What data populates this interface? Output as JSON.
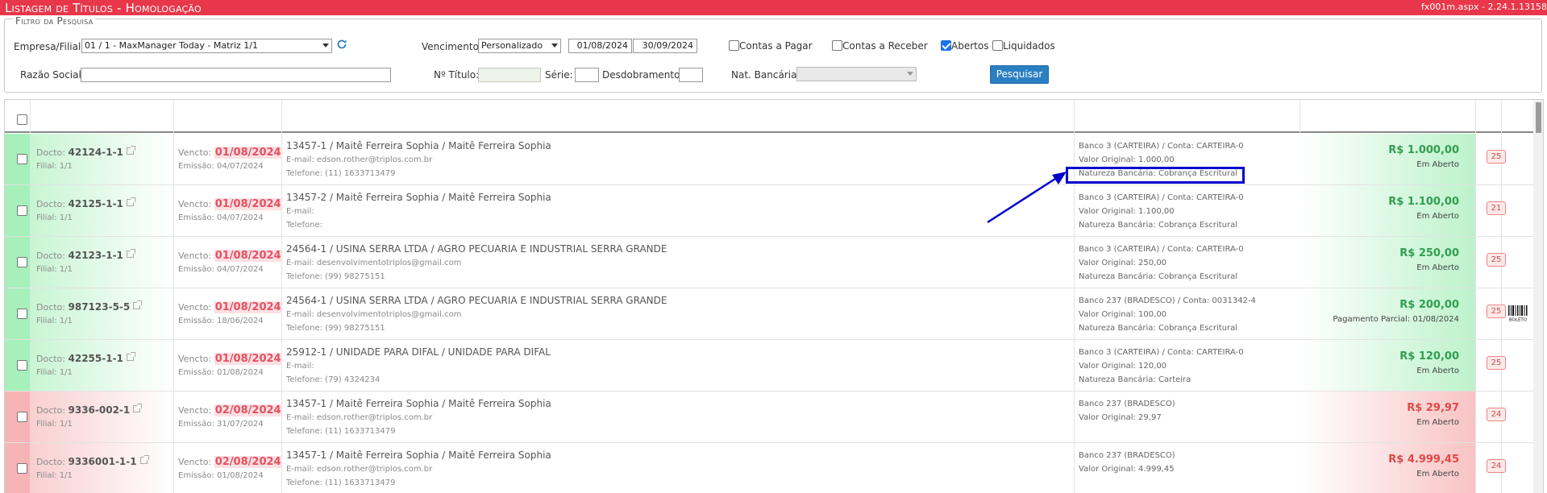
{
  "titlebar": {
    "title": "Listagem de Títulos  - Homologação",
    "version": "fx001m.aspx - 2.24.1.13158"
  },
  "filter": {
    "legend": "Filtro da Pesquisa",
    "empresa_label": "Empresa/Filial:",
    "empresa_value": "01 / 1 - MaxManager Today - Matriz 1/1",
    "vencimento_label": "Vencimento:",
    "vencimento_value": "Personalizado",
    "date_from": "01/08/2024",
    "date_to": "30/09/2024",
    "contas_pagar_label": "Contas a Pagar",
    "contas_receber_label": "Contas a Receber",
    "abertos_label": "Abertos",
    "liquidados_label": "Liquidados",
    "razao_label": "Razão Social:",
    "razao_value": "",
    "ntitulo_label": "Nº Título:",
    "serie_label": "Série:",
    "desdobramento_label": "Desdobramento:",
    "natbancaria_label": "Nat. Bancária:",
    "search_button": "Pesquisar"
  },
  "colors": {
    "titlebar": "#e8374a",
    "accent_button": "#2a7fc1",
    "highlight_box": "#0000cc",
    "arrow": "#0000cc"
  },
  "rows": [
    {
      "status": "green",
      "docto_label": "Docto:",
      "docto": "42124-1-1",
      "filial": "Filial: 1/1",
      "vencto_label": "Vencto:",
      "vencto": "01/08/2024",
      "emissao": "Emissão: 04/07/2024",
      "cliente": "13457-1 / Maitê Ferreira Sophia / Maitê Ferreira Sophia",
      "email": "E-mail: edson.rother@triplos.com.br",
      "telefone": "Telefone: (11) 1633713479",
      "banco": "Banco 3 (CARTEIRA) / Conta: CARTEIRA-0",
      "valor_original": "Valor Original: 1.000,00",
      "natureza": "Natureza Bancária: Cobrança Escritural",
      "valor": "R$ 1.000,00",
      "situacao": "Em Aberto",
      "dias": "25",
      "boleto": false
    },
    {
      "status": "green",
      "docto_label": "Docto:",
      "docto": "42125-1-1",
      "filial": "Filial: 1/1",
      "vencto_label": "Vencto:",
      "vencto": "01/08/2024",
      "emissao": "Emissão: 04/07/2024",
      "cliente": "13457-2 / Maitê Ferreira Sophia / Maitê Ferreira Sophia",
      "email": "E-mail:",
      "telefone": "Telefone:",
      "banco": "Banco 3 (CARTEIRA) / Conta: CARTEIRA-0",
      "valor_original": "Valor Original: 1.100,00",
      "natureza": "Natureza Bancária: Cobrança Escritural",
      "valor": "R$ 1.100,00",
      "situacao": "Em Aberto",
      "dias": "21",
      "boleto": false
    },
    {
      "status": "green",
      "docto_label": "Docto:",
      "docto": "42123-1-1",
      "filial": "Filial: 1/1",
      "vencto_label": "Vencto:",
      "vencto": "01/08/2024",
      "emissao": "Emissão: 04/07/2024",
      "cliente": "24564-1 / USINA SERRA LTDA / AGRO PECUARIA E INDUSTRIAL SERRA GRANDE",
      "email": "E-mail: desenvolvimentotriplos@gmail.com",
      "telefone": "Telefone: (99) 98275151",
      "banco": "Banco 3 (CARTEIRA) / Conta: CARTEIRA-0",
      "valor_original": "Valor Original: 250,00",
      "natureza": "Natureza Bancária: Cobrança Escritural",
      "valor": "R$ 250,00",
      "situacao": "Em Aberto",
      "dias": "25",
      "boleto": false
    },
    {
      "status": "green",
      "docto_label": "Docto:",
      "docto": "987123-5-5",
      "filial": "Filial: 1/1",
      "vencto_label": "Vencto:",
      "vencto": "01/08/2024",
      "emissao": "Emissão: 18/06/2024",
      "cliente": "24564-1 / USINA SERRA LTDA / AGRO PECUARIA E INDUSTRIAL SERRA GRANDE",
      "email": "E-mail: desenvolvimentotriplos@gmail.com",
      "telefone": "Telefone: (99) 98275151",
      "banco": "Banco 237 (BRADESCO) / Conta: 0031342-4",
      "valor_original": "Valor Original: 100,00",
      "natureza": "Natureza Bancária: Cobrança Escritural",
      "valor": "R$ 200,00",
      "situacao": "Pagamento Parcial: 01/08/2024",
      "dias": "25",
      "boleto": true,
      "boleto_label": "BOLETO"
    },
    {
      "status": "green",
      "docto_label": "Docto:",
      "docto": "42255-1-1",
      "filial": "Filial: 1/1",
      "vencto_label": "Vencto:",
      "vencto": "01/08/2024",
      "emissao": "Emissão: 01/08/2024",
      "cliente": "25912-1 / UNIDADE PARA DIFAL / UNIDADE PARA DIFAL",
      "email": "E-mail:",
      "telefone": "Telefone: (79) 4324234",
      "banco": "Banco 3 (CARTEIRA) / Conta: CARTEIRA-0",
      "valor_original": "Valor Original: 120,00",
      "natureza": "Natureza Bancária: Carteira",
      "valor": "R$ 120,00",
      "situacao": "Em Aberto",
      "dias": "25",
      "boleto": false
    },
    {
      "status": "red",
      "docto_label": "Docto:",
      "docto": "9336-002-1",
      "filial": "Filial: 1/1",
      "vencto_label": "Vencto:",
      "vencto": "02/08/2024",
      "emissao": "Emissão: 31/07/2024",
      "cliente": "13457-1 / Maitê Ferreira Sophia / Maitê Ferreira Sophia",
      "email": "E-mail: edson.rother@triplos.com.br",
      "telefone": "Telefone: (11) 1633713479",
      "banco": "Banco 237 (BRADESCO)",
      "valor_original": "Valor Original: 29,97",
      "natureza": "",
      "valor": "R$ 29,97",
      "situacao": "Em Aberto",
      "dias": "24",
      "boleto": false
    },
    {
      "status": "red",
      "docto_label": "Docto:",
      "docto": "9336001-1-1",
      "filial": "Filial: 1/1",
      "vencto_label": "Vencto:",
      "vencto": "02/08/2024",
      "emissao": "Emissão: 01/08/2024",
      "cliente": "13457-1 / Maitê Ferreira Sophia / Maitê Ferreira Sophia",
      "email": "E-mail: edson.rother@triplos.com.br",
      "telefone": "Telefone: (11) 1633713479",
      "banco": "Banco 237 (BRADESCO)",
      "valor_original": "Valor Original: 4.999,45",
      "natureza": "",
      "valor": "R$ 4.999,45",
      "situacao": "Em Aberto",
      "dias": "24",
      "boleto": false
    }
  ]
}
